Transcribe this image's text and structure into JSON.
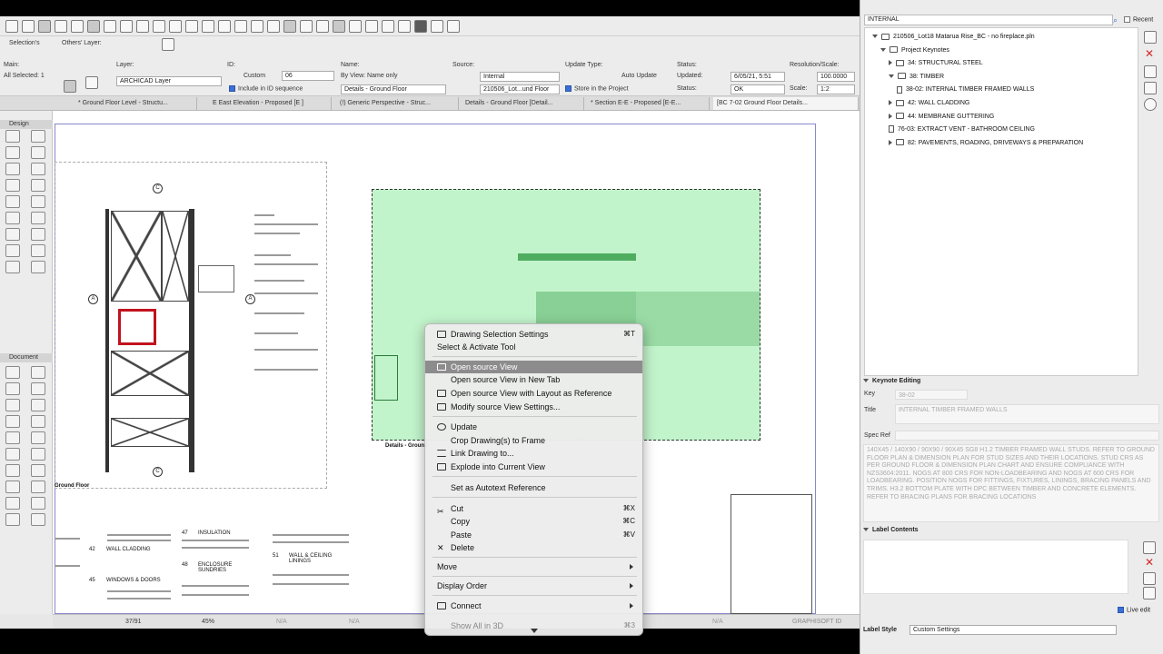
{
  "infobox": {
    "main_label": "Main:",
    "all_selected": "All Selected: 1",
    "selections_label": "Selection's",
    "others_layer_label": "Others' Layer:",
    "layer_label": "Layer:",
    "layer_value": "ARCHICAD Layer",
    "id_label": "ID:",
    "id_custom": "Custom",
    "id_value": "06",
    "include_id_label": "Include in ID sequence",
    "name_label": "Name:",
    "name_mode": "By View: Name only",
    "name_value": "Details - Ground Floor",
    "source_label": "Source:",
    "source_value": "Internal",
    "source_path": "210506_Lot...und Floor",
    "update_type_label": "Update Type:",
    "update_type_value": "Auto Update",
    "store_label": "Store in the Project",
    "status_label": "Status:",
    "updated_label": "Updated:",
    "updated_value": "6/05/21, 5:51",
    "status2_label": "Status:",
    "status_value": "OK",
    "resolution_label": "Resolution/Scale:",
    "resolution_value": "100.0000",
    "scale_label": "Scale:",
    "scale_value": "1:2"
  },
  "tabs": [
    "* Ground Floor Level - Structu...",
    "E East Elevation - Proposed [E ]",
    "(!) Generic Perspective - Struc...",
    "Details - Ground Floor  [Detail...",
    "* Section E-E - Proposed [E-E...",
    "[BC 7-02 Ground Floor Details..."
  ],
  "toolbox": {
    "design_label": "Design",
    "document_label": "Document"
  },
  "canvas": {
    "ground_floor_label": "Ground Floor",
    "drawing_label": "Details - Ground",
    "keynotes": [
      {
        "num": "42",
        "text": "WALL CLADDING"
      },
      {
        "num": "45",
        "text": "WINDOWS & DOORS"
      },
      {
        "num": "47",
        "text": "INSULATION"
      },
      {
        "num": "48",
        "text": "ENCLOSURE SUNDRIES"
      },
      {
        "num": "51",
        "text": "WALL & CEILING LININGS"
      }
    ],
    "markers": [
      "C",
      "C",
      "A",
      "A"
    ]
  },
  "statusbar": {
    "page": "37/91",
    "zoom": "45%",
    "na": "N/A",
    "brand": "GRAPHISOFT ID"
  },
  "context_menu": {
    "items": [
      {
        "label": "Drawing Selection Settings",
        "shortcut": "⌘T",
        "icon": true
      },
      {
        "label": "Select & Activate Tool",
        "shortcut": "",
        "icon": false
      },
      {
        "label": "Open source View",
        "shortcut": "",
        "icon": true,
        "highlight": true
      },
      {
        "label": "Open source View in New Tab",
        "shortcut": "",
        "icon": false
      },
      {
        "label": "Open source View with Layout as Reference",
        "shortcut": "",
        "icon": true
      },
      {
        "label": "Modify source View Settings...",
        "shortcut": "",
        "icon": true
      },
      {
        "label": "Update",
        "shortcut": "",
        "icon": true
      },
      {
        "label": "Crop Drawing(s) to Frame",
        "shortcut": "",
        "icon": false
      },
      {
        "label": "Link Drawing to...",
        "shortcut": "",
        "icon": true
      },
      {
        "label": "Explode into Current View",
        "shortcut": "",
        "icon": true
      },
      {
        "label": "Set as Autotext Reference",
        "shortcut": "",
        "icon": false
      },
      {
        "label": "Cut",
        "shortcut": "⌘X",
        "icon": true
      },
      {
        "label": "Copy",
        "shortcut": "⌘C",
        "icon": false
      },
      {
        "label": "Paste",
        "shortcut": "⌘V",
        "icon": false
      },
      {
        "label": "Delete",
        "shortcut": "",
        "icon": true
      },
      {
        "label": "Move",
        "submenu": true
      },
      {
        "label": "Display Order",
        "submenu": true
      },
      {
        "label": "Connect",
        "submenu": true,
        "icon": true
      },
      {
        "label": "Show All in 3D",
        "shortcut": "⌘3"
      }
    ]
  },
  "right_panel": {
    "search_value": "INTERNAL",
    "recent_label": "Recent",
    "tree": [
      {
        "label": "210506_Lot18 Matarua Rise_BC - no fireplace.pln",
        "level": 0,
        "kind": "file",
        "open": true
      },
      {
        "label": "Project Keynotes",
        "level": 1,
        "kind": "folder",
        "open": true
      },
      {
        "label": "34: STRUCTURAL STEEL",
        "level": 2,
        "kind": "folder",
        "open": false
      },
      {
        "label": "38: TIMBER",
        "level": 2,
        "kind": "folder",
        "open": true
      },
      {
        "label": "38-02: INTERNAL TIMBER FRAMED WALLS",
        "level": 3,
        "kind": "doc"
      },
      {
        "label": "42: WALL CLADDING",
        "level": 2,
        "kind": "folder",
        "open": false
      },
      {
        "label": "44: MEMBRANE GUTTERING",
        "level": 2,
        "kind": "folder",
        "open": false
      },
      {
        "label": "76-03: EXTRACT VENT - BATHROOM CEILING",
        "level": 2,
        "kind": "doc"
      },
      {
        "label": "82: PAVEMENTS, ROADING, DRIVEWAYS & PREPARATION",
        "level": 2,
        "kind": "folder",
        "open": false
      }
    ],
    "keynote_editing_label": "Keynote Editing",
    "key_label": "Key",
    "key_value": "38-02",
    "title_label": "Title",
    "title_value": "INTERNAL TIMBER FRAMED WALLS",
    "spec_ref_label": "Spec Ref",
    "description": "140X45 / 140X90 / 90X90 / 90X45 SG8 H1.2 TIMBER FRAMED WALL STUDS. REFER TO GROUND FLOOR PLAN & DIMENSION PLAN FOR STUD SIZES AND THEIR LOCATIONS. STUD CRS AS PER GROUND FLOOR & DIMENSION PLAN CHART AND ENSURE COMPLIANCE WITH NZS3604:2011. NOGS AT 800 CRS FOR NON-LOADBEARING AND NOGS AT 600 CRS FOR LOADBEARING. POSITION NOGS FOR FITTINGS, FIXTURES, LININGS, BRACING PANELS AND TRIMS. H3.2 BOTTOM PLATE WITH DPC BETWEEN TIMBER AND CONCRETE ELEMENTS. REFER TO BRACING PLANS FOR BRACING LOCATIONS",
    "label_contents_label": "Label Contents",
    "live_edit_label": "Live edit",
    "label_style_label": "Label Style",
    "label_style_value": "Custom Settings"
  }
}
